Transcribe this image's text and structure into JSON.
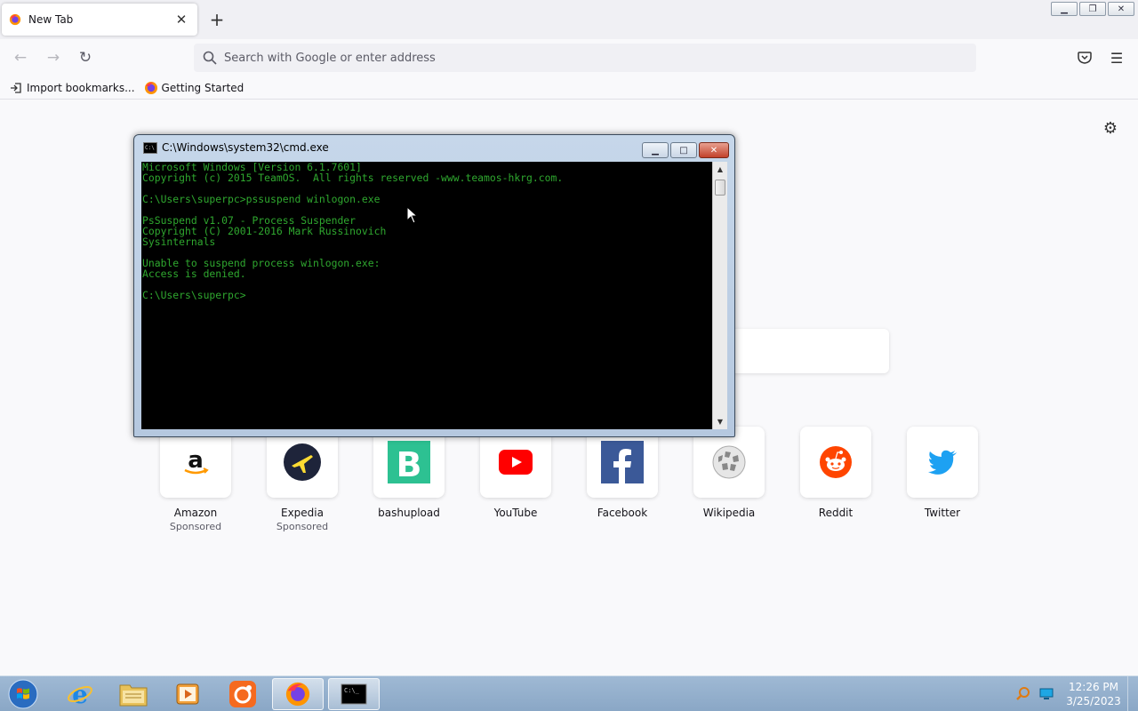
{
  "browser": {
    "tab_title": "New Tab",
    "urlbar_placeholder": "Search with Google or enter address",
    "bookmarks": [
      "Import bookmarks...",
      "Getting Started"
    ]
  },
  "top_sites": [
    {
      "label": "Amazon",
      "sponsored": "Sponsored",
      "icon": "amazon-icon",
      "color": "#000000"
    },
    {
      "label": "Expedia",
      "sponsored": "Sponsored",
      "icon": "expedia-icon",
      "color": "#1e243a"
    },
    {
      "label": "bashupload",
      "sponsored": "",
      "icon": "bashupload-icon",
      "color": "#2dc192"
    },
    {
      "label": "YouTube",
      "sponsored": "",
      "icon": "youtube-icon",
      "color": "#ff0000"
    },
    {
      "label": "Facebook",
      "sponsored": "",
      "icon": "facebook-icon",
      "color": "#3b5998"
    },
    {
      "label": "Wikipedia",
      "sponsored": "",
      "icon": "wikipedia-icon",
      "color": "#999999"
    },
    {
      "label": "Reddit",
      "sponsored": "",
      "icon": "reddit-icon",
      "color": "#ff4500"
    },
    {
      "label": "Twitter",
      "sponsored": "",
      "icon": "twitter-icon",
      "color": "#1da1f2"
    }
  ],
  "cmd": {
    "title": "C:\\Windows\\system32\\cmd.exe",
    "text_color": "#2fa82f",
    "lines": [
      "Microsoft Windows [Version 6.1.7601]",
      "Copyright (c) 2015 TeamOS.  All rights reserved -www.teamos-hkrg.com.",
      "",
      "C:\\Users\\superpc>pssuspend winlogon.exe",
      "",
      "PsSuspend v1.07 - Process Suspender",
      "Copyright (C) 2001-2016 Mark Russinovich",
      "Sysinternals",
      "",
      "Unable to suspend process winlogon.exe:",
      "Access is denied.",
      "",
      "C:\\Users\\superpc>"
    ]
  },
  "taskbar": {
    "time": "12:26 PM",
    "date": "3/25/2023"
  }
}
